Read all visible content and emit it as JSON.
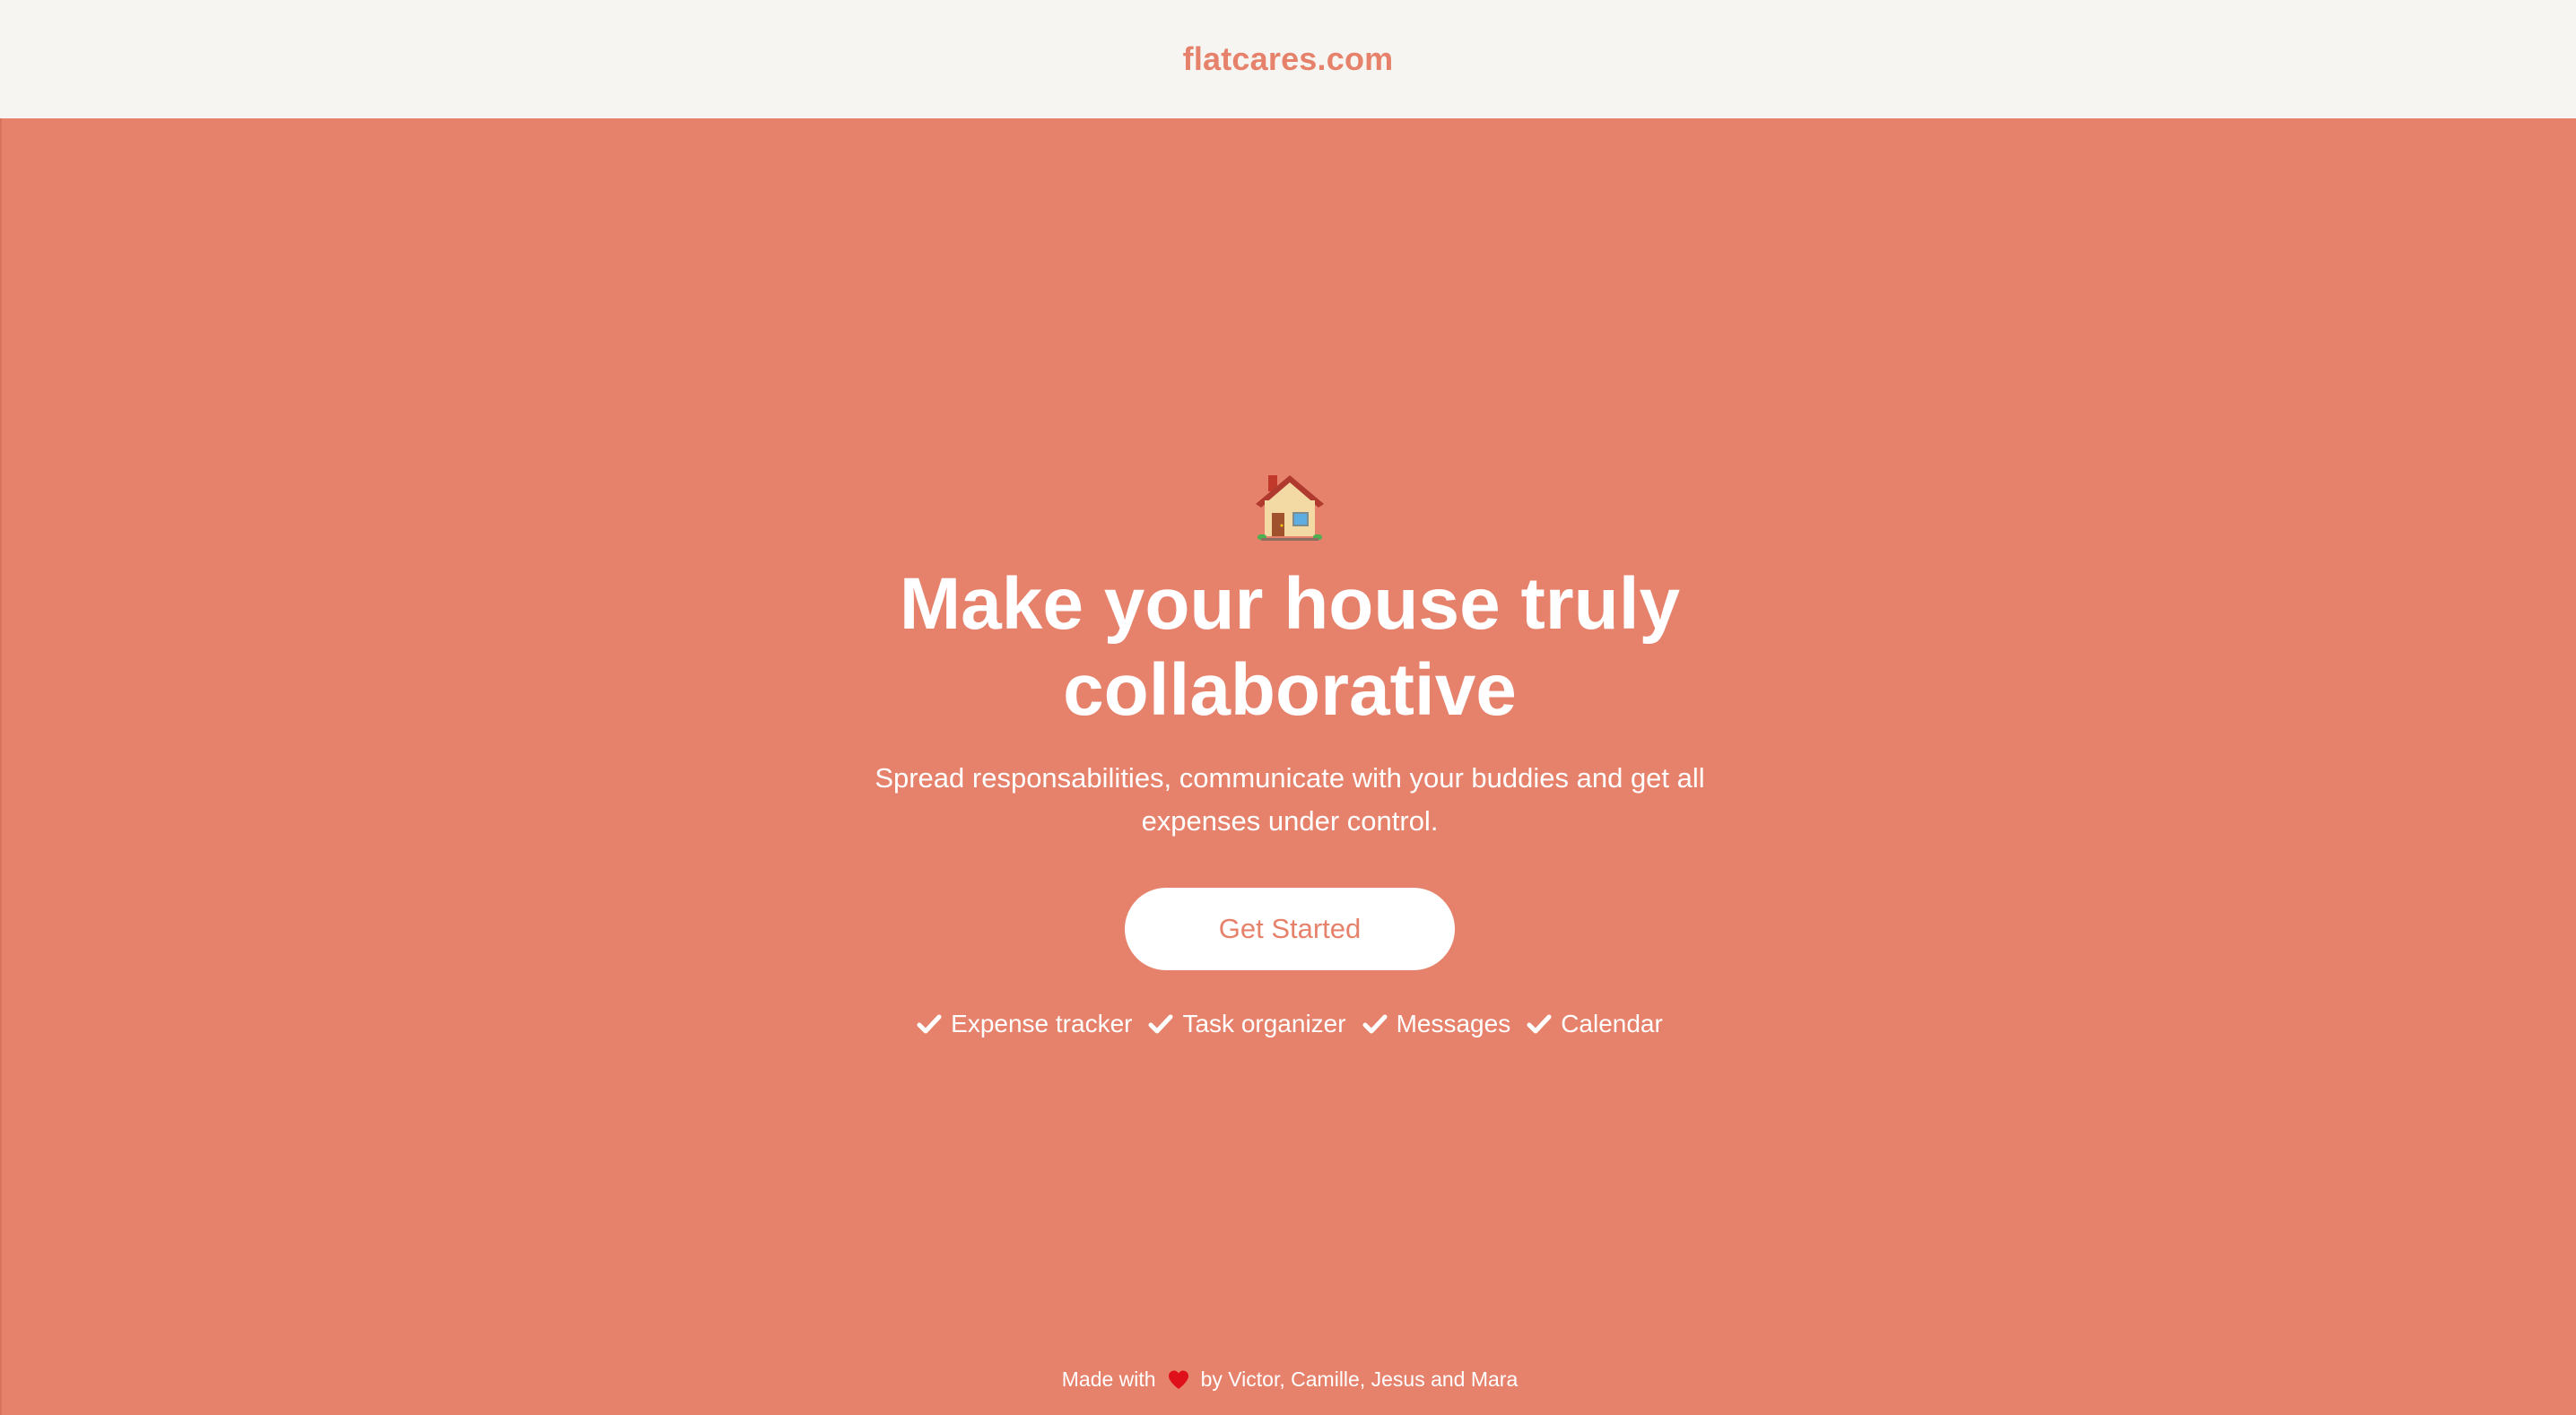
{
  "header": {
    "brand": "flatcares.com"
  },
  "hero": {
    "icon": "house-icon",
    "headline": "Make your house truly collaborative",
    "subtitle": "Spread responsabilities, communicate with your buddies and get all expenses under control.",
    "cta_label": "Get Started",
    "features": [
      {
        "icon": "check-icon",
        "label": "Expense tracker"
      },
      {
        "icon": "check-icon",
        "label": "Task organizer"
      },
      {
        "icon": "check-icon",
        "label": "Messages"
      },
      {
        "icon": "check-icon",
        "label": "Calendar"
      }
    ]
  },
  "footer": {
    "prefix": "Made with",
    "icon": "heart-icon",
    "suffix": "by Victor, Camille, Jesus and Mara"
  },
  "colors": {
    "accent": "#e6826b",
    "header_bg": "#f6f5f1",
    "text_light": "#ffffff"
  }
}
